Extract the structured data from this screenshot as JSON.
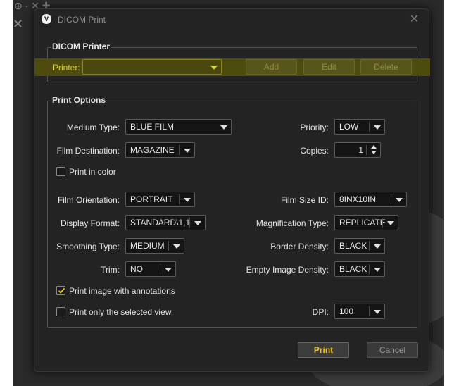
{
  "background": {
    "tools_glyph": "⊕ · ✕ ✚",
    "close_glyph": "✕"
  },
  "dialog": {
    "title": "DICOM Print",
    "logo_glyph": "V",
    "close_glyph": "✕",
    "highlight_color": "#4d4b0e"
  },
  "printer_group": {
    "title": "DICOM Printer",
    "printer_label": "Printer:",
    "printer_value": "",
    "add_label": "Add",
    "edit_label": "Edit",
    "delete_label": "Delete"
  },
  "options": {
    "title": "Print Options",
    "medium_type": {
      "label": "Medium Type:",
      "value": "BLUE FILM"
    },
    "priority": {
      "label": "Priority:",
      "value": "LOW"
    },
    "film_destination": {
      "label": "Film Destination:",
      "value": "MAGAZINE"
    },
    "copies": {
      "label": "Copies:",
      "value": "1"
    },
    "print_in_color": {
      "label": "Print in color",
      "checked": false
    },
    "film_orientation": {
      "label": "Film Orientation:",
      "value": "PORTRAIT"
    },
    "film_size_id": {
      "label": "Film Size ID:",
      "value": "8INX10IN"
    },
    "display_format": {
      "label": "Display Format:",
      "value": "STANDARD\\1,1"
    },
    "magnification_type": {
      "label": "Magnification Type:",
      "value": "REPLICATE"
    },
    "smoothing_type": {
      "label": "Smoothing Type:",
      "value": "MEDIUM"
    },
    "border_density": {
      "label": "Border Density:",
      "value": "BLACK"
    },
    "trim": {
      "label": "Trim:",
      "value": "NO"
    },
    "empty_image_density": {
      "label": "Empty Image Density:",
      "value": "BLACK"
    },
    "print_annotations": {
      "label": "Print image with annotations",
      "checked": true
    },
    "print_selected_view": {
      "label": "Print only the selected view",
      "checked": false
    },
    "dpi": {
      "label": "DPI:",
      "value": "100"
    }
  },
  "footer": {
    "print_label": "Print",
    "cancel_label": "Cancel"
  }
}
